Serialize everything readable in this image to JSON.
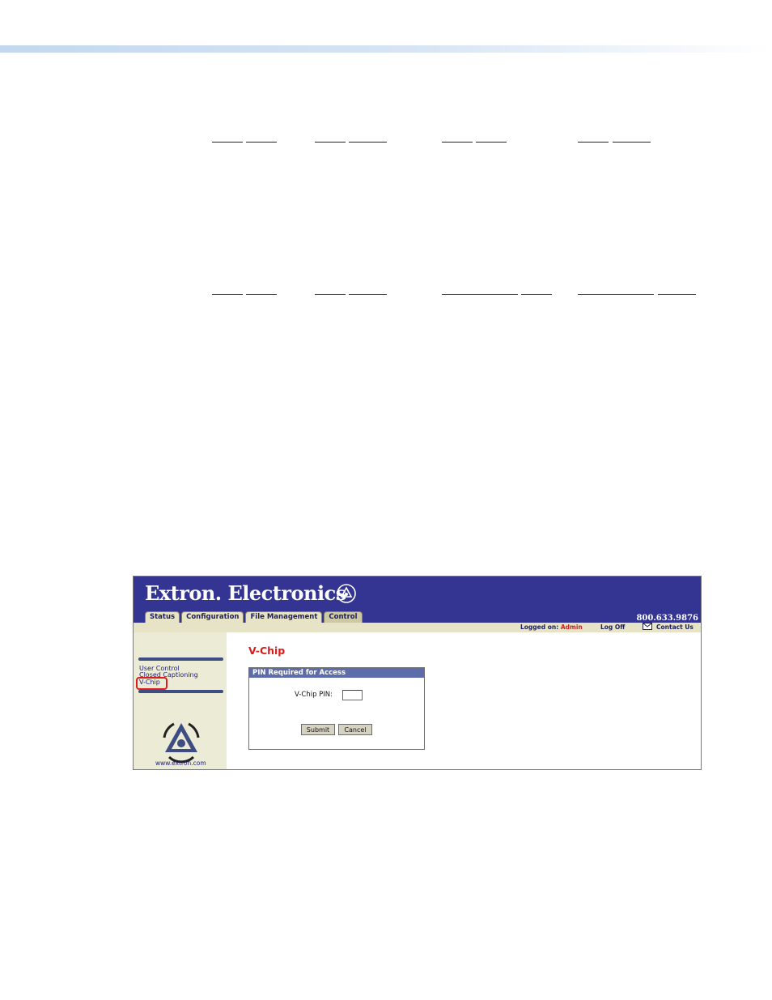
{
  "app": {
    "brand": "Extron. Electronics",
    "phone": "800.633.9876",
    "tabs": [
      {
        "label": "Status"
      },
      {
        "label": "Configuration"
      },
      {
        "label": "File Management"
      },
      {
        "label": "Control"
      }
    ],
    "active_tab": "Control",
    "status_strip": {
      "logged_on_label": "Logged on:",
      "logged_on_user": "Admin",
      "log_off": "Log Off",
      "contact_us": "Contact Us"
    },
    "sidebar": {
      "items": [
        {
          "label": "User Control"
        },
        {
          "label": "Closed Captioning"
        },
        {
          "label": "V-Chip"
        }
      ],
      "selected": "V-Chip",
      "url": "www.extron.com"
    },
    "content": {
      "title": "V-Chip",
      "panel_title": "PIN Required for Access",
      "pin_label": "V-Chip PIN:",
      "pin_value": "",
      "submit_label": "Submit",
      "cancel_label": "Cancel"
    }
  },
  "colors": {
    "header_bg": "#343593",
    "accent_red": "#d81c1c",
    "strip_bg": "#e6e3c6",
    "sidebar_bg": "#ecebd6",
    "panel_header": "#5e6daa"
  },
  "icons": [
    "extron-logo-icon",
    "envelope-icon",
    "service-support-solutions-badge"
  ]
}
